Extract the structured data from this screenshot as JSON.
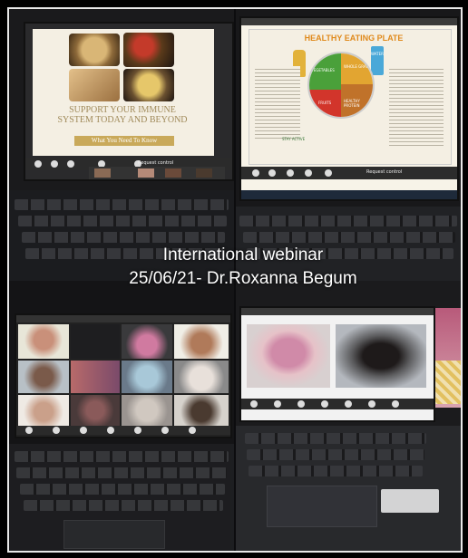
{
  "caption": {
    "line1": "International webinar",
    "line2": "25/06/21- Dr.Roxanna Begum"
  },
  "slide1": {
    "title": "SUPPORT YOUR IMMUNE SYSTEM TODAY AND BEYOND",
    "subtitle": "What You Need To Know"
  },
  "slide2": {
    "title": "HEALTHY EATING PLATE",
    "segments": [
      "VEGETABLES",
      "WHOLE GRAINS",
      "FRUITS",
      "HEALTHY PROTEIN"
    ],
    "water_label": "WATER",
    "oil_label": "HEALTHY OILS",
    "active_label": "STAY ACTIVE"
  },
  "zoom": {
    "request_control": "Request control"
  },
  "colors": {
    "slide_bg": "#f4efe3",
    "slide_title": "#e08a1c",
    "veg": "#4aa03a",
    "grains": "#e2a531",
    "fruit": "#d2352b",
    "protein": "#c0722a"
  }
}
